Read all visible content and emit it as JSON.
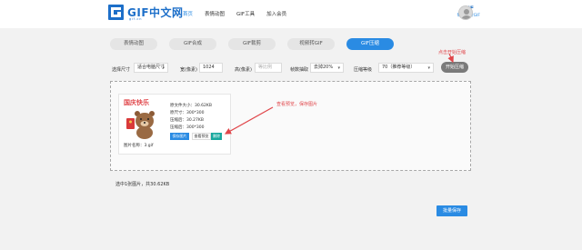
{
  "header": {
    "logo_text": "GIF中文网",
    "logo_sub": "gif.cn",
    "nav": [
      {
        "label": "首页",
        "active": true
      },
      {
        "label": "表情动图",
        "active": false
      },
      {
        "label": "GIF工具",
        "active": false
      },
      {
        "label": "加入会员",
        "active": false
      }
    ],
    "user_title": "GIF",
    "user_sub": "制作上传GIF"
  },
  "tabs": [
    {
      "label": "表情动图",
      "active": false
    },
    {
      "label": "GIF合成",
      "active": false
    },
    {
      "label": "GIF裁剪",
      "active": false
    },
    {
      "label": "视频转GIF",
      "active": false
    },
    {
      "label": "GIF压缩",
      "active": true
    }
  ],
  "annotations": {
    "start": "点击开始压缩",
    "preview": "查看预览，保存图片"
  },
  "toolbar": {
    "size_label": "选择尺寸",
    "size_value": "适合电脑尺寸",
    "width_label": "宽(像素)",
    "width_value": "1024",
    "height_label": "高(像素)",
    "height_placeholder": "等比例",
    "skip_label": "帧数抽取",
    "skip_value": "去掉20%",
    "level_label": "压缩等级",
    "level_value": "70（推荐等级）",
    "start_button": "开始压缩"
  },
  "result": {
    "thumb_title": "国庆快乐",
    "original_size": "原文件大小：30.62KB",
    "original_dims": "原尺寸：300*300",
    "compressed_size": "压缩后：30.27KB",
    "compressed_dims": "压缩后：300*300",
    "btn_download_one": "保存图片",
    "btn_preview": "查看预览",
    "btn_delete": "删除",
    "file_name": "图片名称：3.gif"
  },
  "status": "选中1张图片，共30.62KB",
  "download_all": "批量保存",
  "colors": {
    "accent": "#2a8be3",
    "annotation": "#e0464a",
    "delete": "#18a89e"
  }
}
